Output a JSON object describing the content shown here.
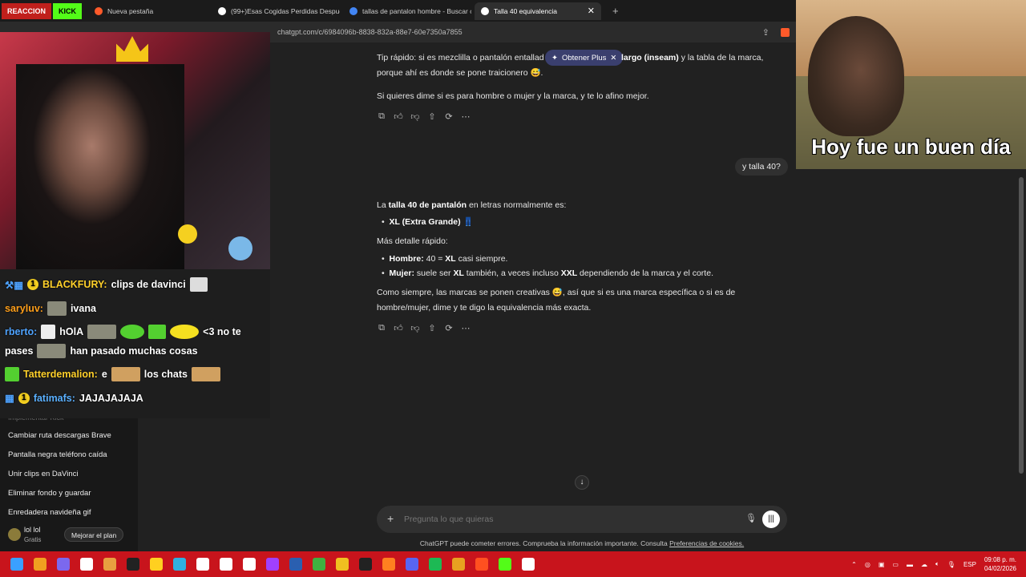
{
  "stream": {
    "badge_reaction": "REACCION",
    "badge_kick": "KICK",
    "chat": [
      {
        "user": "BLACKFURY:",
        "message": "clips de davinci",
        "color": "#ffd02a"
      },
      {
        "user": "saryluv:",
        "message": "ivana",
        "color": "#ff9f1a"
      },
      {
        "user": "rberto:",
        "message": "hOlA",
        "message2": "<3 no te",
        "color": "#4fa3ff"
      },
      {
        "user": "",
        "message": "pases",
        "message2": "han pasado muchas cosas",
        "color": "#ffffff"
      },
      {
        "user": "Tatterdemalion:",
        "message": "e",
        "message2": "los chats",
        "color": "#ffd02a"
      },
      {
        "user": "fatimafs:",
        "message": "JAJAJAJAJA",
        "color": "#5ab0ff"
      }
    ],
    "meme_caption": "Hoy fue un buen día"
  },
  "browser": {
    "tabs": [
      {
        "label": "Nueva pestaña",
        "icon": "brave-icon",
        "color": "#ff5a2a"
      },
      {
        "label": "(99+)Esas Cogidas Perdidas Despué...",
        "icon": "tiktok-icon",
        "color": "#ffffff"
      },
      {
        "label": "tallas de pantalon hombre - Buscar c...",
        "icon": "google-icon",
        "color": "#4285f4"
      },
      {
        "label": "Talla 40 equivalencia",
        "icon": "chatgpt-icon",
        "color": "#ffffff"
      }
    ],
    "url": "chatgpt.com/c/6984096b-8838-832a-88e7-60e7350a7855"
  },
  "sidebar": {
    "items": [
      "Cambiar ruta descargas Brave",
      "Pantalla negra teléfono caída",
      "Unir clips en DaVinci",
      "Eliminar fondo y guardar",
      "Enredadera navideña gif"
    ],
    "faded": "Implementar Kick",
    "user_name": "lol lol",
    "user_plan": "Gratis",
    "upgrade": "Mejorar el plan"
  },
  "conversation": {
    "tip_a": "Tip rápido: si es mezclilla o pantalón entallad",
    "plus_pill": "Obtener Plus",
    "tip_b_bold": "largo (inseam)",
    "tip_b": " y la tabla de la marca,",
    "tip_c": "porque ahí es donde se pone traicionero 😅.",
    "offer": "Si quieres dime si es para hombre o mujer y la marca, y te lo afino mejor.",
    "user_msg": "y talla 40?",
    "ans_a": "La ",
    "ans_bold": "talla 40 de pantalón",
    "ans_b": " en letras normalmente es:",
    "bullet1": "XL (Extra Grande) 👖",
    "more": "Más detalle rápido:",
    "b2_label": "Hombre:",
    "b2_text": " 40 = ",
    "b2_bold": "XL",
    "b2_end": " casi siempre.",
    "b3_label": "Mujer:",
    "b3_text": " suele ser ",
    "b3_bold": "XL",
    "b3_mid": " también, a veces incluso ",
    "b3_bold2": "XXL",
    "b3_end": " dependiendo de la marca y el corte.",
    "final_a": "Como siempre, las marcas se ponen creativas 😅, así que si es una marca específica o si es de",
    "final_b": "hombre/mujer, dime y te digo la equivalencia más exacta."
  },
  "composer": {
    "placeholder": "Pregunta lo que quieras",
    "disclaimer": "ChatGPT puede cometer errores. Comprueba la información importante. Consulta ",
    "disclaimer_link": "Preferencias de cookies."
  },
  "taskbar": {
    "lang": "ESP",
    "time": "09:08 p. m.",
    "date": "04/02/2026",
    "icons": [
      "windows-icon",
      "stack-icon",
      "teams-icon",
      "capcut-icon",
      "chicken-icon",
      "obs-icon",
      "lightning-icon",
      "edge-icon",
      "notion-icon",
      "github-icon",
      "obsidian-icon",
      "circle-icon",
      "photoshop-icon",
      "xbox-icon",
      "folder-icon",
      "steam-icon",
      "firefox-icon",
      "discord-icon",
      "spotify-icon",
      "chrome-icon",
      "brave-icon",
      "kick-icon",
      "refresh-icon"
    ],
    "icon_colors": [
      "#3aa0ff",
      "#f0a020",
      "#7b68ee",
      "#ffffff",
      "#e8a040",
      "#222222",
      "#ffd020",
      "#2fb0e0",
      "#ffffff",
      "#ffffff",
      "#ffffff",
      "#a040ff",
      "#2a5fb0",
      "#40b040",
      "#f0c020",
      "#222222",
      "#ff8020",
      "#5865f2",
      "#1db954",
      "#e8a020",
      "#ff5020",
      "#53fc18",
      "#ffffff"
    ]
  }
}
